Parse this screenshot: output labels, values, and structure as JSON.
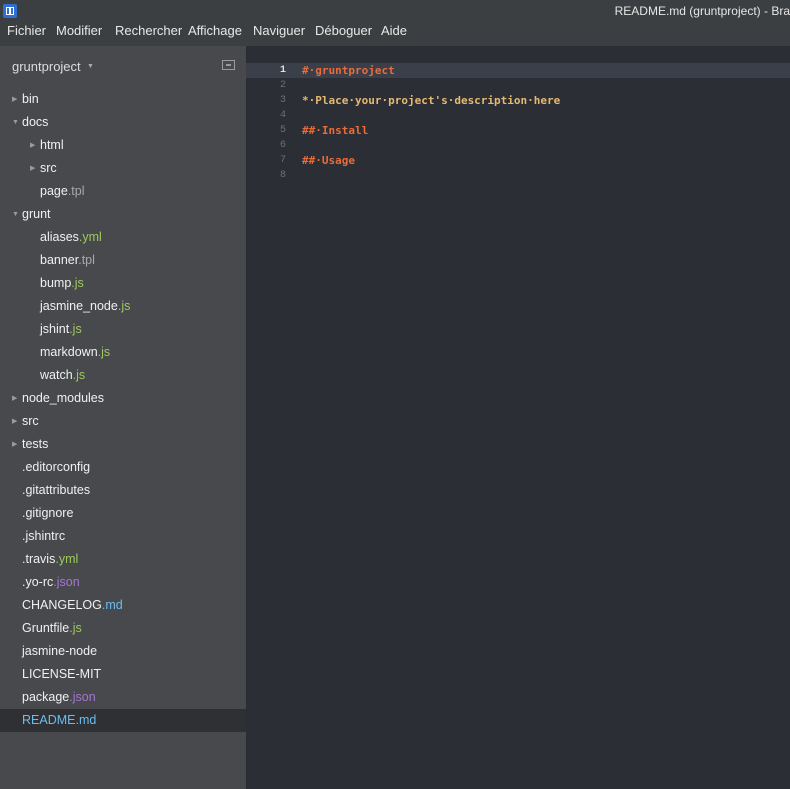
{
  "window": {
    "title": "README.md (gruntproject) - Bra"
  },
  "menu": [
    "Fichier",
    "Modifier",
    "Rechercher",
    "Affichage",
    "Naviguer",
    "Déboguer",
    "Aide"
  ],
  "sidebar": {
    "project": "gruntproject",
    "items": [
      {
        "name": "bin",
        "ext": "",
        "level": 0,
        "arrow": "collapsed",
        "selected": false
      },
      {
        "name": "docs",
        "ext": "",
        "level": 0,
        "arrow": "expanded",
        "selected": false
      },
      {
        "name": "html",
        "ext": "",
        "level": 1,
        "arrow": "collapsed",
        "selected": false
      },
      {
        "name": "src",
        "ext": "",
        "level": 1,
        "arrow": "collapsed",
        "selected": false
      },
      {
        "name": "page",
        "ext": ".tpl",
        "level": 1,
        "arrow": "",
        "selected": false
      },
      {
        "name": "grunt",
        "ext": "",
        "level": 0,
        "arrow": "expanded",
        "selected": false
      },
      {
        "name": "aliases",
        "ext": ".yml",
        "level": 1,
        "arrow": "",
        "selected": false
      },
      {
        "name": "banner",
        "ext": ".tpl",
        "level": 1,
        "arrow": "",
        "selected": false
      },
      {
        "name": "bump",
        "ext": ".js",
        "level": 1,
        "arrow": "",
        "selected": false
      },
      {
        "name": "jasmine_node",
        "ext": ".js",
        "level": 1,
        "arrow": "",
        "selected": false
      },
      {
        "name": "jshint",
        "ext": ".js",
        "level": 1,
        "arrow": "",
        "selected": false
      },
      {
        "name": "markdown",
        "ext": ".js",
        "level": 1,
        "arrow": "",
        "selected": false
      },
      {
        "name": "watch",
        "ext": ".js",
        "level": 1,
        "arrow": "",
        "selected": false
      },
      {
        "name": "node_modules",
        "ext": "",
        "level": 0,
        "arrow": "collapsed",
        "selected": false
      },
      {
        "name": "src",
        "ext": "",
        "level": 0,
        "arrow": "collapsed",
        "selected": false
      },
      {
        "name": "tests",
        "ext": "",
        "level": 0,
        "arrow": "collapsed",
        "selected": false
      },
      {
        "name": ".editorconfig",
        "ext": "",
        "level": 0,
        "arrow": "",
        "selected": false
      },
      {
        "name": ".gitattributes",
        "ext": "",
        "level": 0,
        "arrow": "",
        "selected": false
      },
      {
        "name": ".gitignore",
        "ext": "",
        "level": 0,
        "arrow": "",
        "selected": false
      },
      {
        "name": ".jshintrc",
        "ext": "",
        "level": 0,
        "arrow": "",
        "selected": false
      },
      {
        "name": ".travis",
        "ext": ".yml",
        "level": 0,
        "arrow": "",
        "selected": false
      },
      {
        "name": ".yo-rc",
        "ext": ".json",
        "level": 0,
        "arrow": "",
        "selected": false
      },
      {
        "name": "CHANGELOG",
        "ext": ".md",
        "level": 0,
        "arrow": "",
        "selected": false
      },
      {
        "name": "Gruntfile",
        "ext": ".js",
        "level": 0,
        "arrow": "",
        "selected": false
      },
      {
        "name": "jasmine-node",
        "ext": "",
        "level": 0,
        "arrow": "",
        "selected": false
      },
      {
        "name": "LICENSE-MIT",
        "ext": "",
        "level": 0,
        "arrow": "",
        "selected": false
      },
      {
        "name": "package",
        "ext": ".json",
        "level": 0,
        "arrow": "",
        "selected": false
      },
      {
        "name": "README",
        "ext": ".md",
        "level": 0,
        "arrow": "",
        "selected": true
      }
    ]
  },
  "editor": {
    "active_line": 1,
    "lines": [
      {
        "num": "1",
        "tokens": [
          {
            "t": "#·gruntproject",
            "c": "h"
          }
        ]
      },
      {
        "num": "2",
        "tokens": []
      },
      {
        "num": "3",
        "tokens": [
          {
            "t": "*·Place·your·project's·description·here",
            "c": "p"
          }
        ]
      },
      {
        "num": "4",
        "tokens": []
      },
      {
        "num": "5",
        "tokens": [
          {
            "t": "##·Install",
            "c": "h"
          }
        ]
      },
      {
        "num": "6",
        "tokens": []
      },
      {
        "num": "7",
        "tokens": [
          {
            "t": "##·Usage",
            "c": "h"
          }
        ]
      },
      {
        "num": "8",
        "tokens": []
      }
    ]
  },
  "colors": {
    "ext_js": "#9fc95d",
    "ext_yml": "#9fc95d",
    "ext_tpl": "#a9a9a9",
    "ext_json": "#a476d4",
    "ext_md": "#6bbdf0",
    "heading": "#e96c3a",
    "text": "#e6b973"
  }
}
